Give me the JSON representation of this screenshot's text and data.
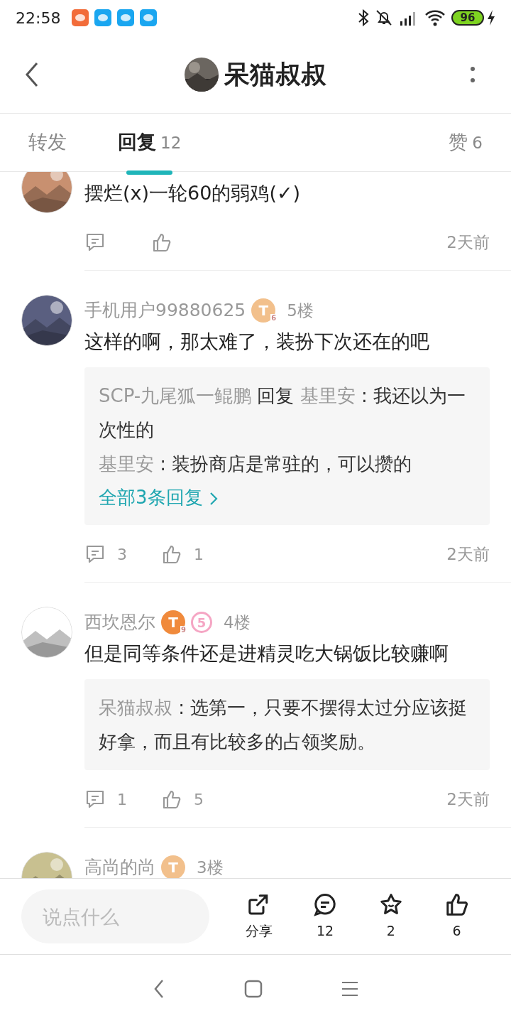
{
  "status_bar": {
    "time": "22:58",
    "battery": "96"
  },
  "header": {
    "title": "呆猫叔叔"
  },
  "tabs": [
    {
      "label": "转发",
      "selected": false
    },
    {
      "label": "回复",
      "count": "12",
      "selected": true
    },
    {
      "label": "赞",
      "count": "6",
      "selected": false
    }
  ],
  "comments": [
    {
      "body": "摆烂(x)一轮60的弱鸡(✓)",
      "time": "2天前"
    },
    {
      "name": "手机用户99880625",
      "badges": [
        {
          "kind": "level",
          "letter": "T",
          "grade": "6",
          "color": "#f2c08c"
        }
      ],
      "floor": "5楼",
      "body": "这样的啊，那太难了，装扮下次还在的吧",
      "replies": [
        [
          {
            "kind": "user",
            "text": "SCP-九尾狐一鲲鹏"
          },
          {
            "kind": "plain",
            "text": " 回复 "
          },
          {
            "kind": "user",
            "text": "基里安"
          },
          {
            "kind": "plain",
            "text": " : 我还以为一次性的"
          }
        ],
        [
          {
            "kind": "user",
            "text": "基里安"
          },
          {
            "kind": "plain",
            "text": " : 装扮商店是常驻的，可以攒的"
          }
        ]
      ],
      "more": "全部3条回复",
      "reply_count": "3",
      "like_count": "1",
      "time": "2天前"
    },
    {
      "name": "西坎恩尔",
      "badges": [
        {
          "kind": "level",
          "letter": "T",
          "grade": "9",
          "color": "#f08a3c"
        },
        {
          "kind": "heart",
          "text": "5",
          "color": "#f5a6c4"
        }
      ],
      "floor": "4楼",
      "body": "但是同等条件还是进精灵吃大锅饭比较赚啊",
      "replies": [
        [
          {
            "kind": "user",
            "text": "呆猫叔叔"
          },
          {
            "kind": "plain",
            "text": " : 选第一，只要不摆得太过分应该挺好拿，而且有比较多的占领奖励。"
          }
        ]
      ],
      "reply_count": "1",
      "like_count": "5",
      "time": "2天前"
    },
    {
      "name": "高尚的尚",
      "badges": [
        {
          "kind": "level",
          "letter": "T",
          "color": "#f2c08c"
        }
      ],
      "floor": "3楼"
    }
  ],
  "bottom_bar": {
    "placeholder": "说点什么",
    "actions": [
      {
        "kind": "share",
        "label": "分享"
      },
      {
        "kind": "comment",
        "label": "12"
      },
      {
        "kind": "star",
        "label": "2"
      },
      {
        "kind": "like",
        "label": "6"
      }
    ]
  }
}
